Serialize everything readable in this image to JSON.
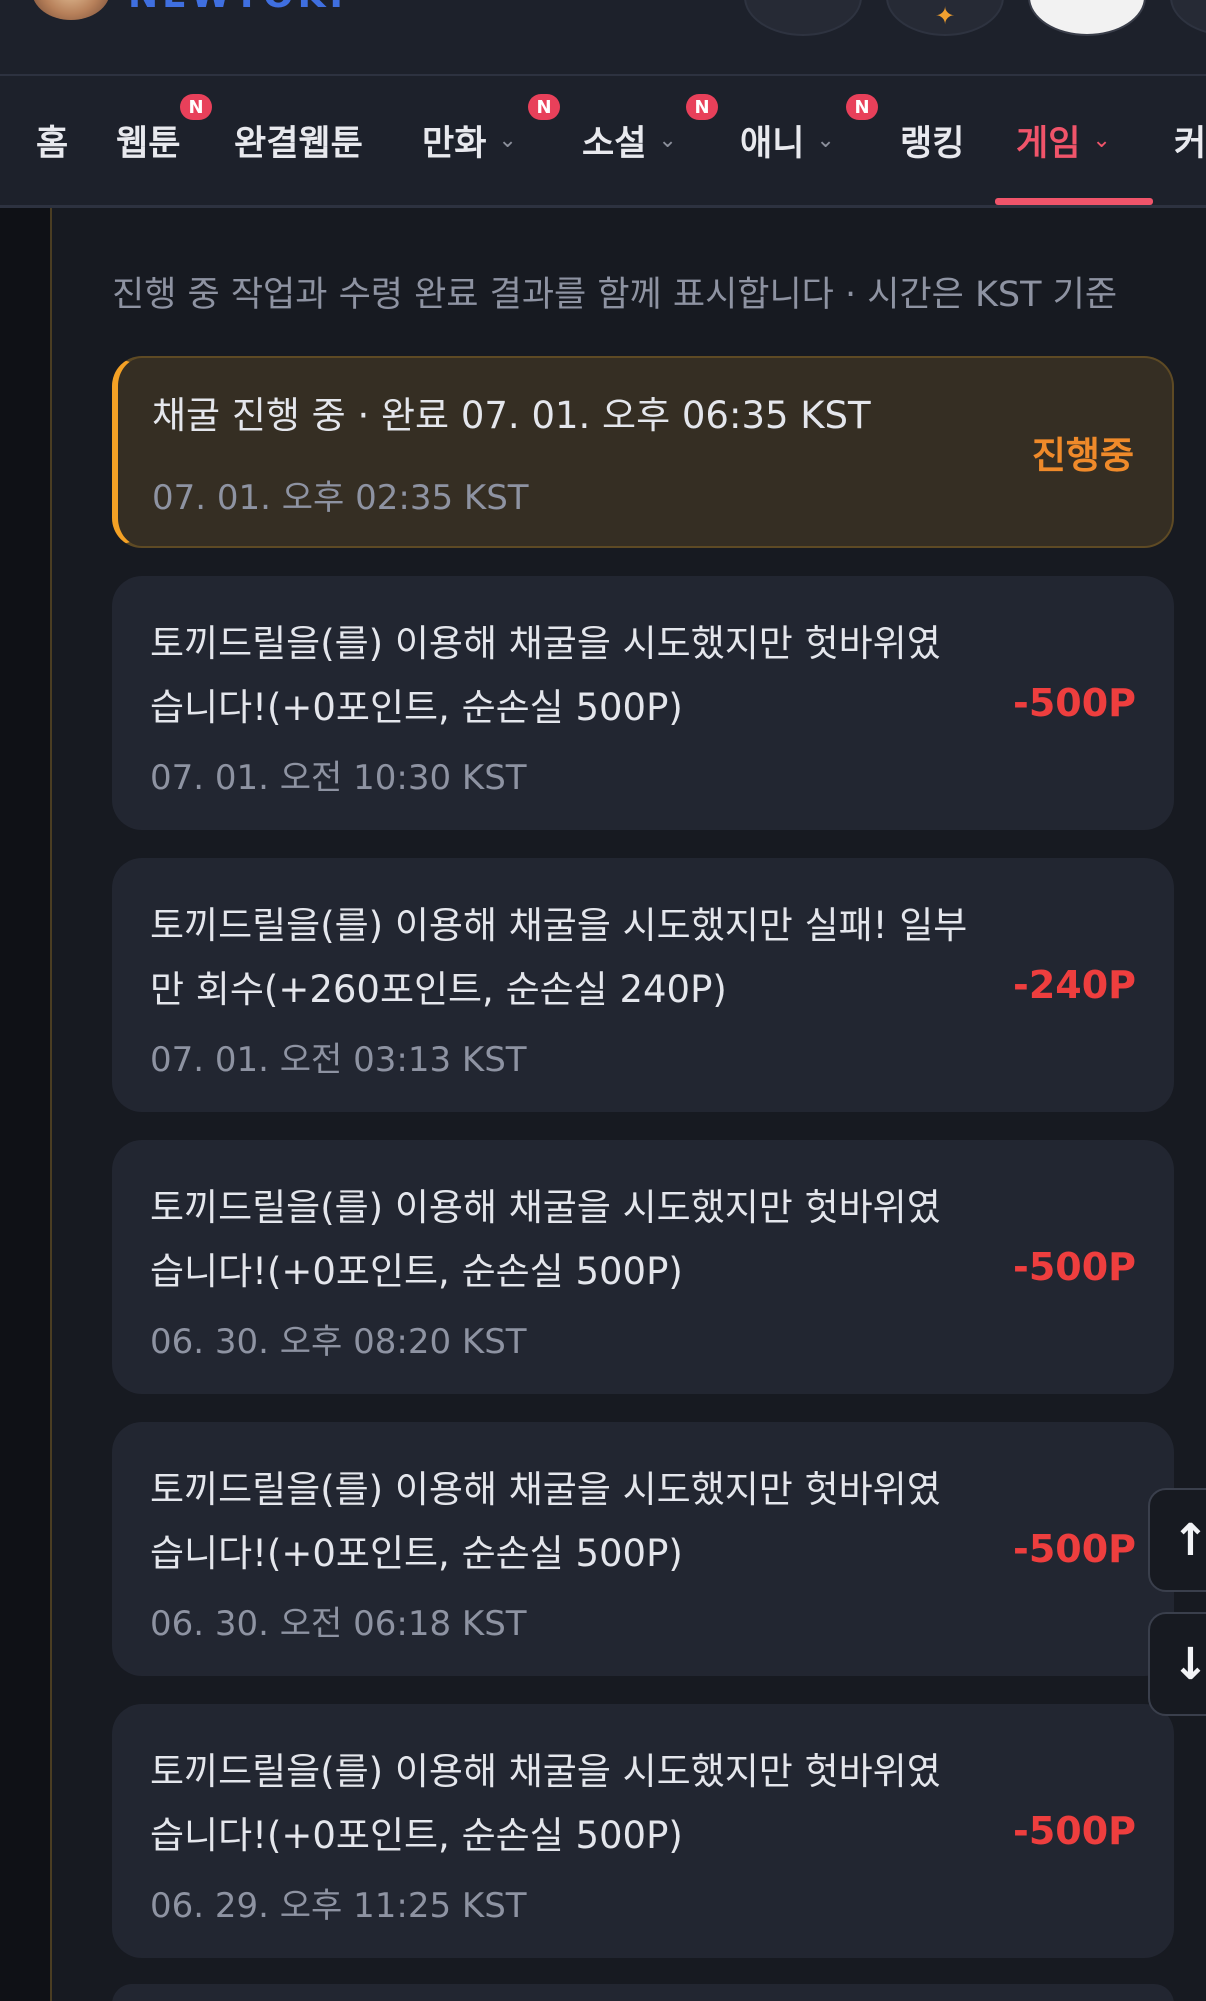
{
  "header": {
    "logo_text": "NEWTOKI",
    "icons": [
      "search-icon",
      "fire-icon",
      "user-avatar",
      "menu-icon"
    ]
  },
  "nav": {
    "items": [
      {
        "label": "홈",
        "badge": "",
        "chevron": ""
      },
      {
        "label": "웹툰",
        "badge": "N",
        "chevron": ""
      },
      {
        "label": "완결웹툰",
        "badge": "",
        "chevron": ""
      },
      {
        "label": "만화",
        "badge": "N",
        "chevron": "⌄"
      },
      {
        "label": "소설",
        "badge": "N",
        "chevron": "⌄"
      },
      {
        "label": "애니",
        "badge": "N",
        "chevron": "⌄"
      },
      {
        "label": "랭킹",
        "badge": "",
        "chevron": ""
      },
      {
        "label": "게임",
        "badge": "",
        "chevron": "⌄",
        "active": true
      },
      {
        "label": "커",
        "badge": "",
        "chevron": ""
      }
    ]
  },
  "main": {
    "subtitle": "진행 중 작업과 수령 완료 결과를 함께 표시합니다 · 시간은 KST 기준",
    "entries": [
      {
        "text": "채굴 진행 중 · 완료 07. 01. 오후 06:35 KST",
        "time": "07. 01. 오후 02:35 KST",
        "amount": "진행중",
        "status": "in-progress"
      },
      {
        "text": "토끼드릴을(를) 이용해 채굴을 시도했지만 헛바위였습니다!(+0포인트, 순손실 500P)",
        "time": "07. 01. 오전 10:30 KST",
        "amount": "-500P",
        "status": "loss"
      },
      {
        "text": "토끼드릴을(를) 이용해 채굴을 시도했지만 실패! 일부만 회수(+260포인트, 순손실 240P)",
        "time": "07. 01. 오전 03:13 KST",
        "amount": "-240P",
        "status": "loss"
      },
      {
        "text": "토끼드릴을(를) 이용해 채굴을 시도했지만 헛바위였습니다!(+0포인트, 순손실 500P)",
        "time": "06. 30. 오후 08:20 KST",
        "amount": "-500P",
        "status": "loss"
      },
      {
        "text": "토끼드릴을(를) 이용해 채굴을 시도했지만 헛바위였습니다!(+0포인트, 순손실 500P)",
        "time": "06. 30. 오전 06:18 KST",
        "amount": "-500P",
        "status": "loss"
      },
      {
        "text": "토끼드릴을(를) 이용해 채굴을 시도했지만 헛바위였습니다!(+0포인트, 순손실 500P)",
        "time": "06. 29. 오후 11:25 KST",
        "amount": "-500P",
        "status": "loss"
      }
    ]
  },
  "scroll": {
    "up_icon": "↑",
    "down_icon": "↓"
  },
  "colors": {
    "background": "#171a21",
    "card": "#222631",
    "accent_active": "#f0546a",
    "loss": "#ee3e3e",
    "in_progress": "#ef8a2a",
    "badge": "#e8405a"
  }
}
